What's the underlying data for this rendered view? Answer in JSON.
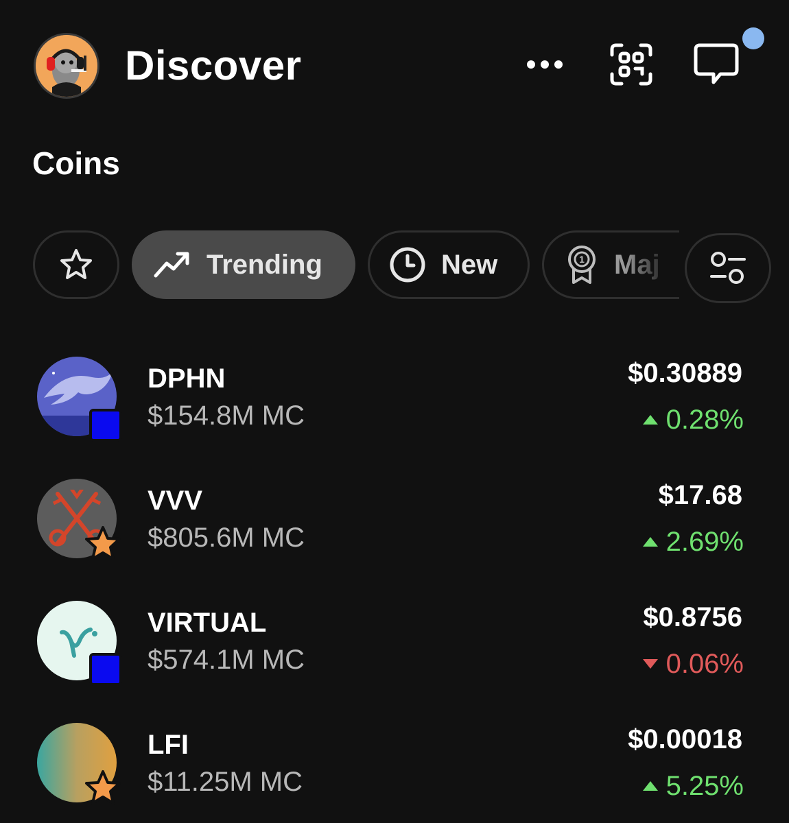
{
  "header": {
    "title": "Discover",
    "icons": [
      "more-icon",
      "scan-icon",
      "chat-icon"
    ],
    "notification_dot_color": "#8ab8f0"
  },
  "section_title": "Coins",
  "filters": {
    "chips": [
      {
        "icon": "star-icon",
        "label": "",
        "selected": false
      },
      {
        "icon": "trending-icon",
        "label": "Trending",
        "selected": true
      },
      {
        "icon": "clock-icon",
        "label": "New",
        "selected": false
      },
      {
        "icon": "medal-icon",
        "label": "Maj",
        "selected": false
      },
      {
        "icon": "filter-icon",
        "label": "",
        "selected": false
      }
    ]
  },
  "coins": [
    {
      "symbol": "DPHN",
      "market_cap": "$154.8M MC",
      "price": "$0.30889",
      "change": "0.28%",
      "direction": "up",
      "badge": "square-badge"
    },
    {
      "symbol": "VVV",
      "market_cap": "$805.6M MC",
      "price": "$17.68",
      "change": "2.69%",
      "direction": "up",
      "badge": "star-badge"
    },
    {
      "symbol": "VIRTUAL",
      "market_cap": "$574.1M MC",
      "price": "$0.8756",
      "change": "0.06%",
      "direction": "down",
      "badge": "square-badge"
    },
    {
      "symbol": "LFI",
      "market_cap": "$11.25M MC",
      "price": "$0.00018",
      "change": "5.25%",
      "direction": "up",
      "badge": "star-badge"
    }
  ],
  "colors": {
    "background": "#111111",
    "positive": "#6fe06f",
    "negative": "#e05a5a",
    "selected_chip": "#4a4a4a",
    "badge_blue": "#0a0af0",
    "badge_star": "#f39a4a"
  }
}
